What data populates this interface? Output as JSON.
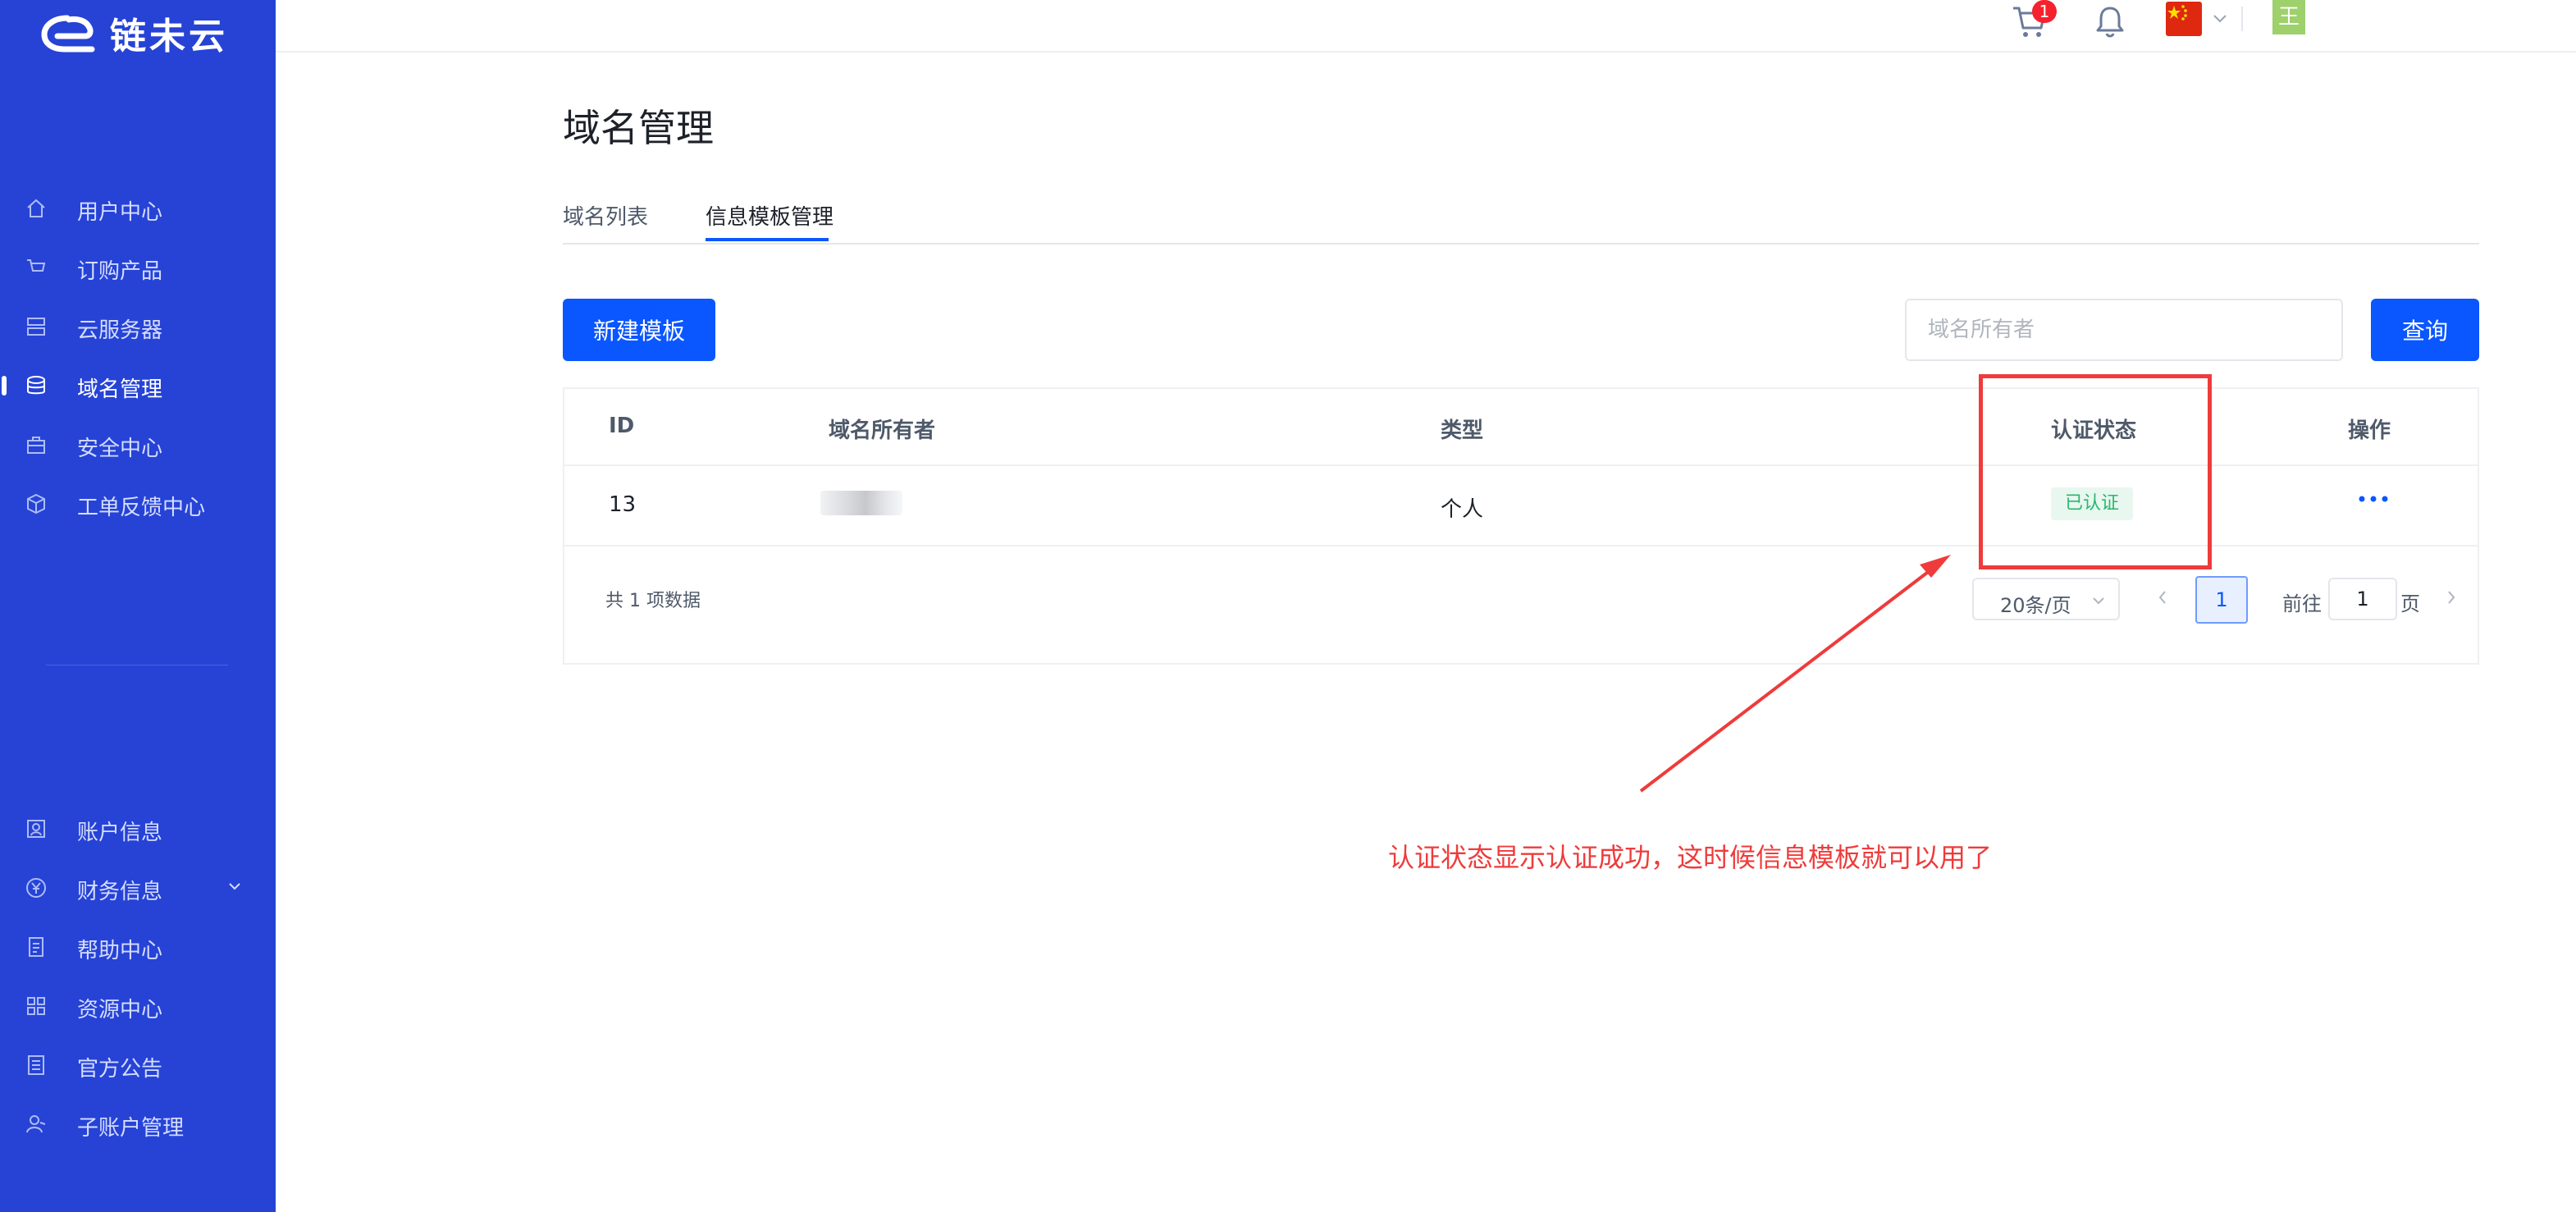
{
  "brand": {
    "name": "链未云"
  },
  "sidebar": {
    "top_items": [
      {
        "label": "用户中心",
        "icon": "home-icon"
      },
      {
        "label": "订购产品",
        "icon": "cart-icon"
      },
      {
        "label": "云服务器",
        "icon": "server-icon"
      },
      {
        "label": "域名管理",
        "icon": "database-icon",
        "active": true
      },
      {
        "label": "安全中心",
        "icon": "briefcase-icon"
      },
      {
        "label": "工单反馈中心",
        "icon": "cube-icon"
      }
    ],
    "bottom_items": [
      {
        "label": "账户信息",
        "icon": "user-card-icon"
      },
      {
        "label": "财务信息",
        "icon": "yuan-icon",
        "expandable": true
      },
      {
        "label": "帮助中心",
        "icon": "document-icon"
      },
      {
        "label": "资源中心",
        "icon": "grid-icon"
      },
      {
        "label": "官方公告",
        "icon": "notice-icon"
      },
      {
        "label": "子账户管理",
        "icon": "sub-account-icon"
      }
    ]
  },
  "topbar": {
    "cart_count": "1",
    "user_initial": "王"
  },
  "colors": {
    "sidebar_bg": "#2643d6",
    "primary": "#0a56ff",
    "annotation": "#ef3b3b",
    "success": "#27b86b"
  },
  "page": {
    "title": "域名管理",
    "tabs": [
      {
        "label": "域名列表",
        "active": false
      },
      {
        "label": "信息模板管理",
        "active": true
      }
    ]
  },
  "toolbar": {
    "new_label": "新建模板",
    "search_placeholder": "域名所有者",
    "query_label": "查询"
  },
  "table": {
    "columns": [
      "ID",
      "域名所有者",
      "类型",
      "认证状态",
      "操作"
    ],
    "rows": [
      {
        "id": "13",
        "owner": "",
        "type": "个人",
        "status": "已认证"
      }
    ]
  },
  "pagination": {
    "total_text": "共 1 项数据",
    "page_size": "20条/页",
    "current_page": "1",
    "goto_label": "前往",
    "goto_value": "1",
    "page_label": "页"
  },
  "annotation": {
    "text": "认证状态显示认证成功，这时候信息模板就可以用了"
  }
}
